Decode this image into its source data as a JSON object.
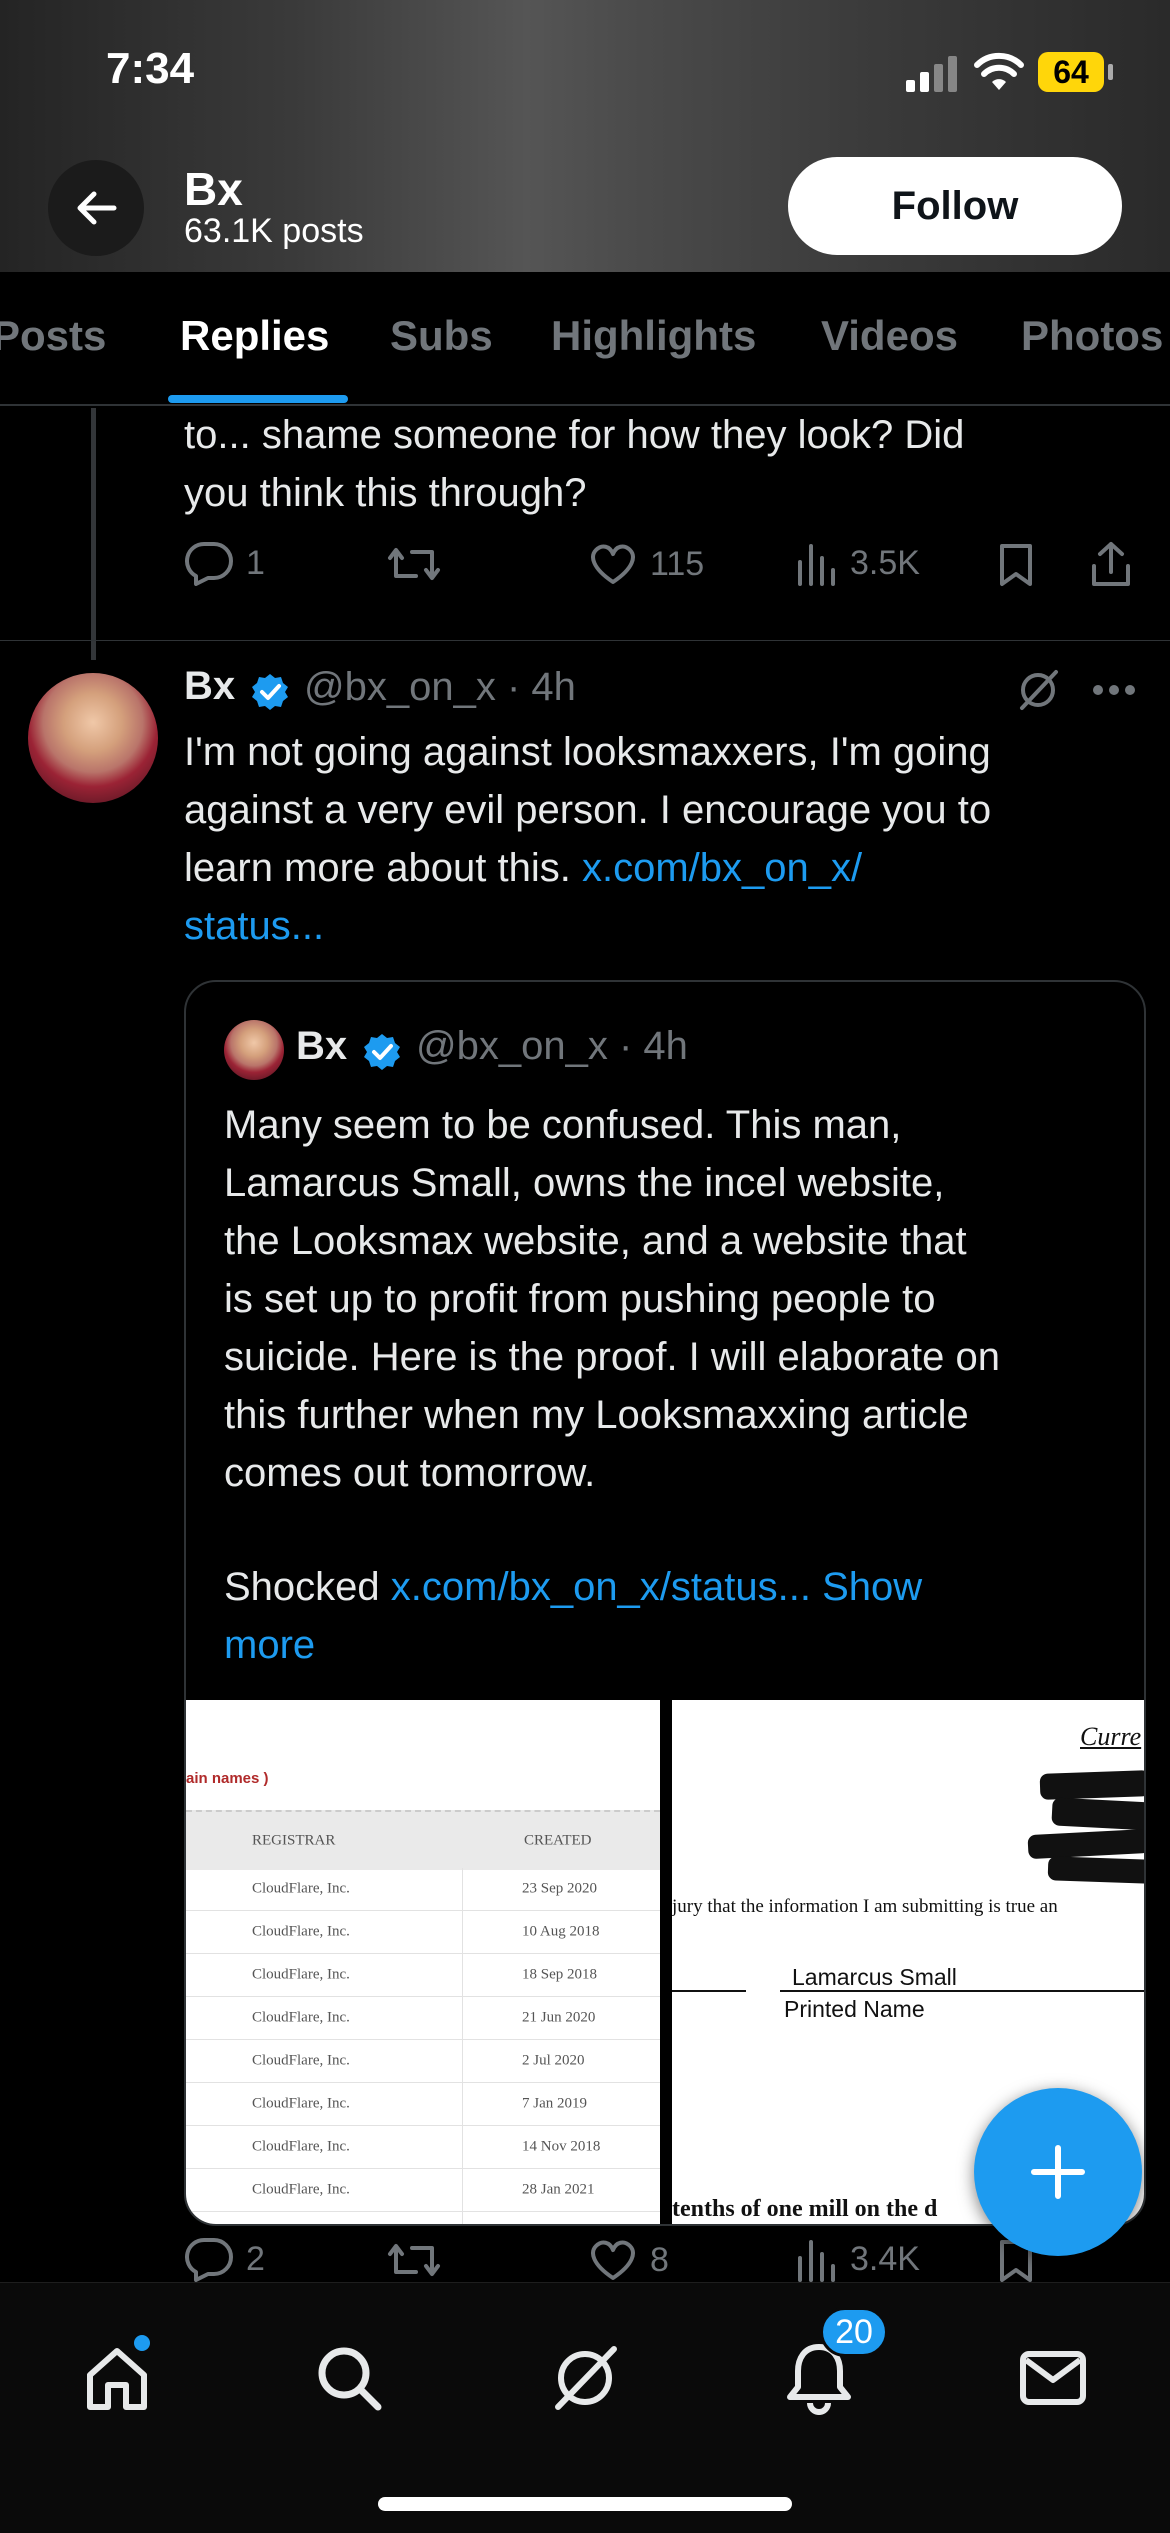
{
  "status_bar": {
    "time": "7:34",
    "battery": "64"
  },
  "profile_header": {
    "name": "Bx",
    "post_count": "63.1K posts",
    "follow_label": "Follow"
  },
  "tabs": [
    {
      "label": "Posts"
    },
    {
      "label": "Replies",
      "active": true
    },
    {
      "label": "Subs"
    },
    {
      "label": "Highlights"
    },
    {
      "label": "Videos"
    },
    {
      "label": "Photos"
    }
  ],
  "prev_post": {
    "text_line1": "to... shame someone for how they look? Did",
    "text_line2": "you think this through?",
    "replies": "1",
    "likes": "115",
    "views": "3.5K"
  },
  "post": {
    "author": "Bx",
    "handle_time": "@bx_on_x · 4h",
    "text_line1": "I'm not going against looksmaxxers, I'm going",
    "text_line2": "against a very evil person. I encourage you to",
    "text_line3": "learn more about this. ",
    "link_part1": "x.com/bx_on_x/",
    "link_part2": "status...",
    "replies": "2",
    "likes": "8",
    "views": "3.4K"
  },
  "quoted_post": {
    "author": "Bx",
    "handle_time": "@bx_on_x · 4h",
    "lines": [
      "Many seem to be confused. This man,",
      "Lamarcus Small, owns the incel website,",
      "the Looksmax website, and a website that",
      "is set up to profit from pushing people to",
      "suicide. Here is the proof. I will elaborate on",
      "this further when my Looksmaxxing article",
      "comes out tomorrow."
    ],
    "last_prefix": "Shocked ",
    "last_link": "x.com/bx_on_x/status...",
    "show_more_1": " Show",
    "show_more_2": "more"
  },
  "image_left": {
    "heading": "ain names )",
    "col_registrar": "REGISTRAR",
    "col_created": "CREATED",
    "rows": [
      {
        "registrar": "CloudFlare, Inc.",
        "created": "23 Sep 2020"
      },
      {
        "registrar": "CloudFlare, Inc.",
        "created": "10 Aug 2018"
      },
      {
        "registrar": "CloudFlare, Inc.",
        "created": "18 Sep 2018"
      },
      {
        "registrar": "CloudFlare, Inc.",
        "created": "21 Jun 2020"
      },
      {
        "registrar": "CloudFlare, Inc.",
        "created": "2 Jul 2020"
      },
      {
        "registrar": "CloudFlare, Inc.",
        "created": "7 Jan 2019"
      },
      {
        "registrar": "CloudFlare, Inc.",
        "created": "14 Nov 2018"
      },
      {
        "registrar": "CloudFlare, Inc.",
        "created": "28 Jan 2021"
      }
    ]
  },
  "image_right": {
    "corner": "Curre",
    "jury_line": "jury that the information I am submitting is true an",
    "signer_name": "Lamarcus Small",
    "printed_name": "Printed Name",
    "bottom_fragment": "tenths of one mill on the d"
  },
  "bottom_nav": {
    "notifications_count": "20"
  },
  "colors": {
    "accent": "#1d9bf0",
    "background": "#000000",
    "muted": "#71767b"
  }
}
